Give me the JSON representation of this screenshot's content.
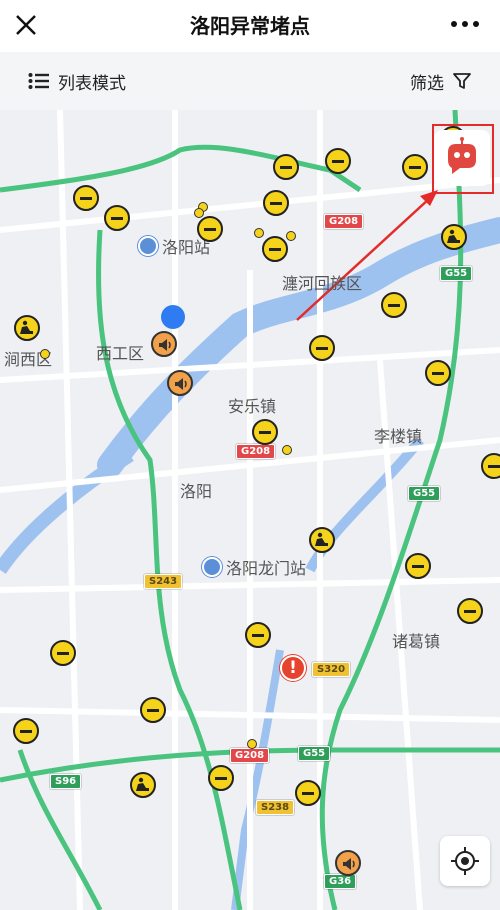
{
  "header": {
    "title": "洛阳异常堵点"
  },
  "toolbar": {
    "list_mode_label": "列表模式",
    "filter_label": "筛选"
  },
  "map": {
    "places": [
      {
        "label": "瀍河回族区"
      },
      {
        "label": "西工区"
      },
      {
        "label": "涧西区"
      },
      {
        "label": "安乐镇"
      },
      {
        "label": "李楼镇"
      },
      {
        "label": "洛阳"
      },
      {
        "label": "诸葛镇"
      }
    ],
    "pois": [
      {
        "label": "洛阳站"
      },
      {
        "label": "洛阳龙门站"
      }
    ],
    "shields": [
      {
        "label": "G208"
      },
      {
        "label": "G208"
      },
      {
        "label": "G208"
      },
      {
        "label": "G55"
      },
      {
        "label": "G55"
      },
      {
        "label": "G55"
      },
      {
        "label": "S243"
      },
      {
        "label": "S320"
      },
      {
        "label": "S238"
      },
      {
        "label": "S96"
      },
      {
        "label": "G36"
      }
    ],
    "colors": {
      "highway": "#49c37e",
      "river": "#9ec2f0",
      "road": "#ffffff",
      "annotation": "#e52a2a"
    }
  }
}
